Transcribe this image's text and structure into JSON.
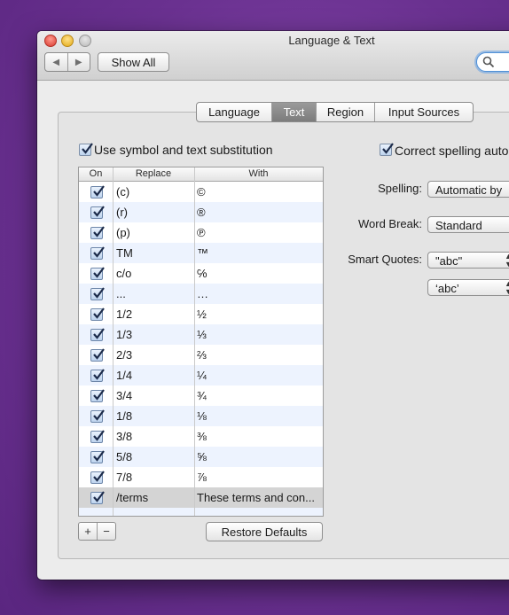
{
  "window": {
    "title": "Language & Text",
    "nav_back": "◀",
    "nav_forward": "▶",
    "show_all_label": "Show All"
  },
  "tabs": [
    {
      "label": "Language",
      "active": false
    },
    {
      "label": "Text",
      "active": true
    },
    {
      "label": "Region",
      "active": false
    },
    {
      "label": "Input Sources",
      "active": false
    }
  ],
  "substitution": {
    "checkbox_label": "Use symbol and text substitution",
    "checked": true,
    "columns": {
      "on": "On",
      "replace": "Replace",
      "with": "With"
    },
    "rows": [
      {
        "replace": "(c)",
        "with": "©",
        "on": true
      },
      {
        "replace": "(r)",
        "with": "®",
        "on": true
      },
      {
        "replace": "(p)",
        "with": "℗",
        "on": true
      },
      {
        "replace": "TM",
        "with": "™",
        "on": true
      },
      {
        "replace": "c/o",
        "with": "℅",
        "on": true
      },
      {
        "replace": "...",
        "with": "…",
        "on": true
      },
      {
        "replace": "1/2",
        "with": "½",
        "on": true
      },
      {
        "replace": "1/3",
        "with": "⅓",
        "on": true
      },
      {
        "replace": "2/3",
        "with": "⅔",
        "on": true
      },
      {
        "replace": "1/4",
        "with": "¼",
        "on": true
      },
      {
        "replace": "3/4",
        "with": "¾",
        "on": true
      },
      {
        "replace": "1/8",
        "with": "⅛",
        "on": true
      },
      {
        "replace": "3/8",
        "with": "⅜",
        "on": true
      },
      {
        "replace": "5/8",
        "with": "⅝",
        "on": true
      },
      {
        "replace": "7/8",
        "with": "⅞",
        "on": true
      },
      {
        "replace": "/terms",
        "with": "These terms and con...",
        "on": true,
        "selected": true
      }
    ],
    "add_label": "+",
    "remove_label": "−",
    "restore_label": "Restore Defaults"
  },
  "right": {
    "correct_spelling_label": "Correct spelling auto",
    "correct_spelling_checked": true,
    "spelling_label": "Spelling:",
    "spelling_value": "Automatic by",
    "word_break_label": "Word Break:",
    "word_break_value": "Standard",
    "smart_quotes_label": "Smart Quotes:",
    "double_quotes_value": "\"abc\"",
    "single_quotes_value": "‘abc’"
  },
  "icons": {
    "search": "magnifier-icon",
    "check": "checkmark-icon"
  }
}
